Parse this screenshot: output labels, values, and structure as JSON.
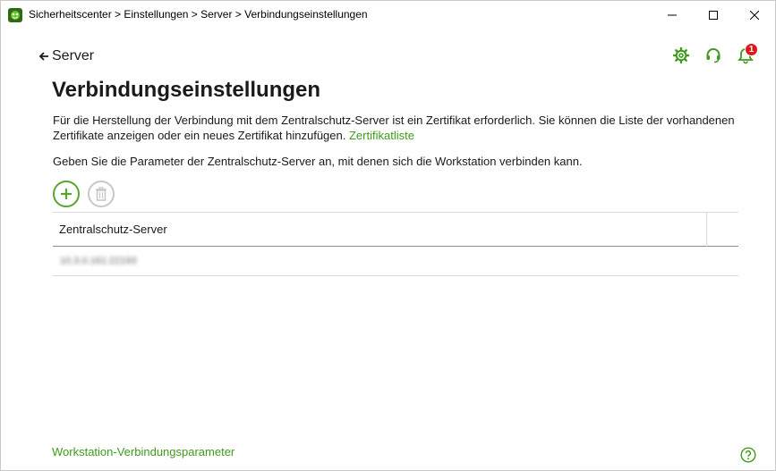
{
  "window": {
    "title": "Sicherheitscenter > Einstellungen > Server > Verbindungseinstellungen"
  },
  "header": {
    "back_label": "Server",
    "notification_count": "1"
  },
  "main": {
    "title": "Verbindungseinstellungen",
    "description_text": "Für die Herstellung der Verbindung mit dem Zentralschutz-Server ist ein Zertifikat erforderlich. Sie können die Liste der vorhandenen Zertifikate anzeigen oder ein neues Zertifikat hinzufügen. ",
    "certificate_link": "Zertifikatliste",
    "instruction": "Geben Sie die Parameter der Zentralschutz-Server an, mit denen sich die Workstation verbinden kann."
  },
  "table": {
    "columns": [
      "Zentralschutz-Server"
    ],
    "rows": [
      {
        "server": "10.3.0.161:22193"
      }
    ]
  },
  "footer": {
    "link": "Workstation-Verbindungsparameter"
  },
  "icons": {
    "app": "dr-web-spider-icon",
    "back": "arrow-left-icon",
    "settings": "gear-icon",
    "support": "headset-icon",
    "notifications": "bell-icon",
    "add": "plus-circle-icon",
    "delete": "trash-icon",
    "help": "question-mark-icon"
  },
  "colors": {
    "accent_green": "#3f9a1d",
    "badge_red": "#e0161f",
    "disabled_gray": "#c8c8c8"
  }
}
